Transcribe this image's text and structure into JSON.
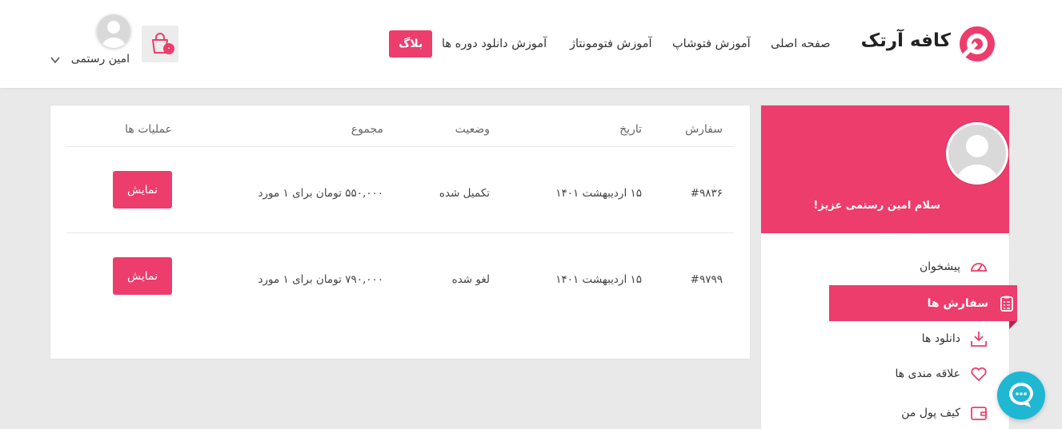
{
  "brand": {
    "name": "کافه آرتک",
    "color": "#ec3d6c"
  },
  "nav": {
    "home": "صفحه اصلی",
    "photoshop": "آموزش فتوشاپ",
    "photomontage": "آموزش فتومونتاژ",
    "downloads": "آموزش دانلود دوره ها",
    "blog": "بلاگ"
  },
  "cart": {
    "count": "۰",
    "icon": "shopping-bag-icon"
  },
  "user": {
    "name": "امین رستمی",
    "greeting": "سلام امین رستمی عزیز!"
  },
  "orders": {
    "headers": {
      "order": "سفارش",
      "date": "تاریخ",
      "status": "وضعیت",
      "total": "مجموع",
      "actions": "عملیات ها"
    },
    "rows": [
      {
        "id": "#۹۸۳۶",
        "date": "۱۵ اردیبهشت ۱۴۰۱",
        "status": "تکمیل شده",
        "total": "۵۵۰,۰۰۰ تومان برای ۱ مورد",
        "action": "نمایش"
      },
      {
        "id": "#۹۷۹۹",
        "date": "۱۵ اردیبهشت ۱۴۰۱",
        "status": "لغو شده",
        "total": "۷۹۰,۰۰۰ تومان برای ۱ مورد",
        "action": "نمایش"
      }
    ]
  },
  "menu": {
    "dashboard": "پیشخوان",
    "orders": "سفارش ها",
    "downloads": "دانلود ها",
    "wishlist": "علاقه مندی ها",
    "wallet": "کیف پول من"
  }
}
